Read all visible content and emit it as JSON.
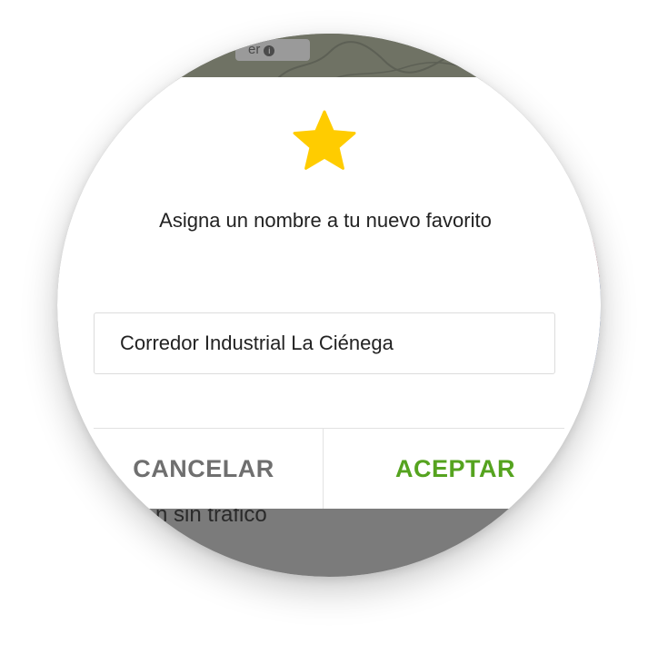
{
  "map": {
    "chip_text": "er",
    "info_glyph": "i",
    "side_chip_text": "0",
    "traffic_text": "n sin tráfico"
  },
  "dialog": {
    "star_icon": "star-icon",
    "title": "Asigna un nombre a tu nuevo favorito",
    "input_value": "Corredor Industrial La Ciénega",
    "cancel_label": "CANCELAR",
    "accept_label": "ACEPTAR"
  },
  "colors": {
    "star": "#FFCC00",
    "accept": "#55A31F",
    "cancel": "#6F6F6F",
    "overlay": "#7B7B7B"
  }
}
